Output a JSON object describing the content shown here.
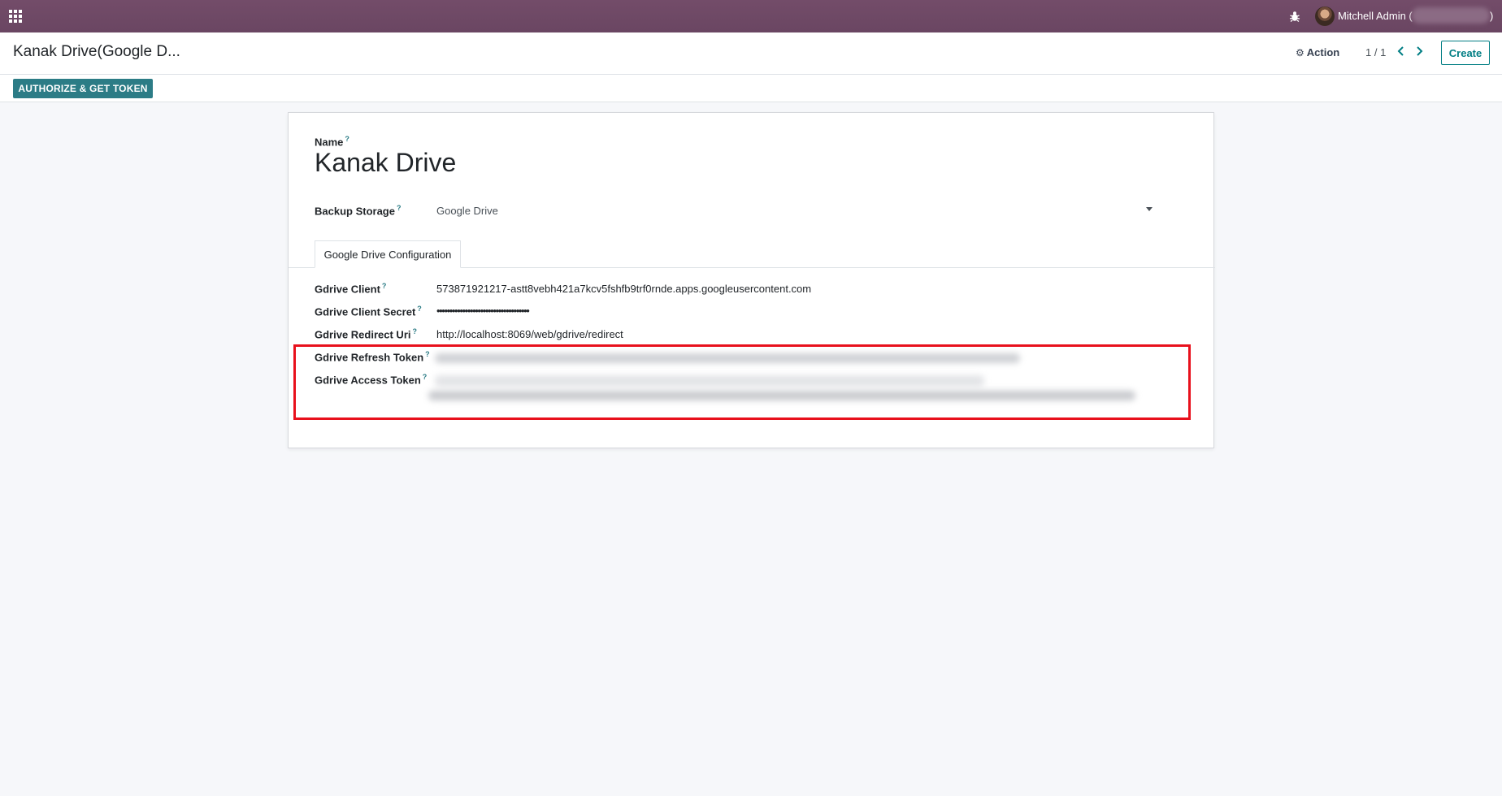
{
  "navbar": {
    "apps_icon": "apps-grid-icon",
    "bug_icon": "bug-icon",
    "avatar_icon": "avatar",
    "user_name": "Mitchell Admin (",
    "user_paren_close": ")",
    "colors": {
      "background": "#714b67"
    }
  },
  "control_panel": {
    "breadcrumb": "Kanak Drive(Google D...",
    "action_label": "Action",
    "action_icon": "gear-icon",
    "pager_value": "1 / 1",
    "pager_prev_icon": "chevron-left-icon",
    "pager_next_icon": "chevron-right-icon",
    "create_label": "Create",
    "authorize_label": "AUTHORIZE & GET TOKEN",
    "colors": {
      "accent": "#017e84",
      "authorize_bg": "#2c7c86"
    }
  },
  "form": {
    "name_label": "Name",
    "name_value": "Kanak Drive",
    "backup_storage_label": "Backup Storage",
    "backup_storage_value": "Google Drive",
    "tab_label": "Google Drive Configuration",
    "help_mark": "?",
    "fields": {
      "client_label": "Gdrive Client",
      "client_value": "573871921217-astt8vebh421a7kcv5fshfb9trf0rnde.apps.googleusercontent.com",
      "client_secret_label": "Gdrive Client Secret",
      "client_secret_value": "••••••••••••••••••••••••••••••••••••",
      "redirect_uri_label": "Gdrive Redirect Uri",
      "redirect_uri_value": "http://localhost:8069/web/gdrive/redirect",
      "refresh_token_label": "Gdrive Refresh Token",
      "access_token_label": "Gdrive Access Token"
    },
    "highlight_color": "#e8101c"
  }
}
